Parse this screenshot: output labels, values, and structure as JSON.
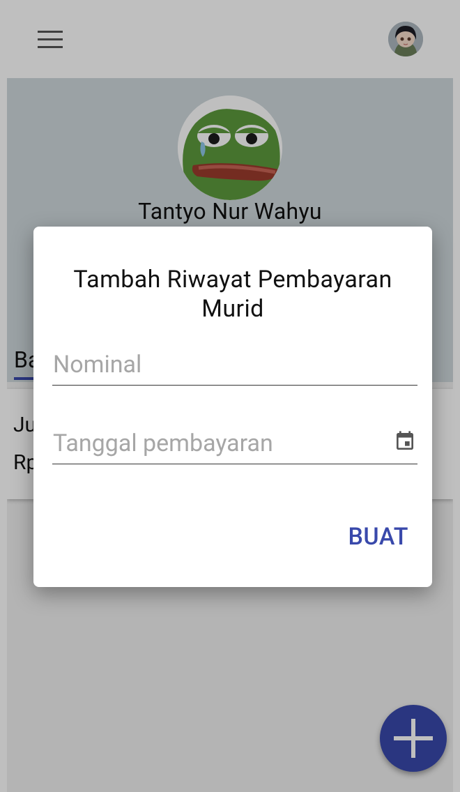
{
  "profile": {
    "name": "Tantyo Nur Wahyu"
  },
  "tabs": {
    "active_label_fragment": "Ba"
  },
  "card": {
    "line1_fragment": "Ju",
    "line2_fragment": "Rp"
  },
  "dialog": {
    "title": "Tambah Riwayat Pembayaran Murid",
    "nominal_placeholder": "Nominal",
    "date_placeholder": "Tanggal pembayaran",
    "create_label": "BUAT"
  },
  "icons": {
    "menu": "menu-icon",
    "calendar": "calendar-icon",
    "add": "add-icon",
    "more": "more-vert-icon"
  },
  "colors": {
    "accent": "#3949ab",
    "hero_background": "#cfd8dc",
    "scrim": "rgba(0,0,0,0.25)"
  }
}
